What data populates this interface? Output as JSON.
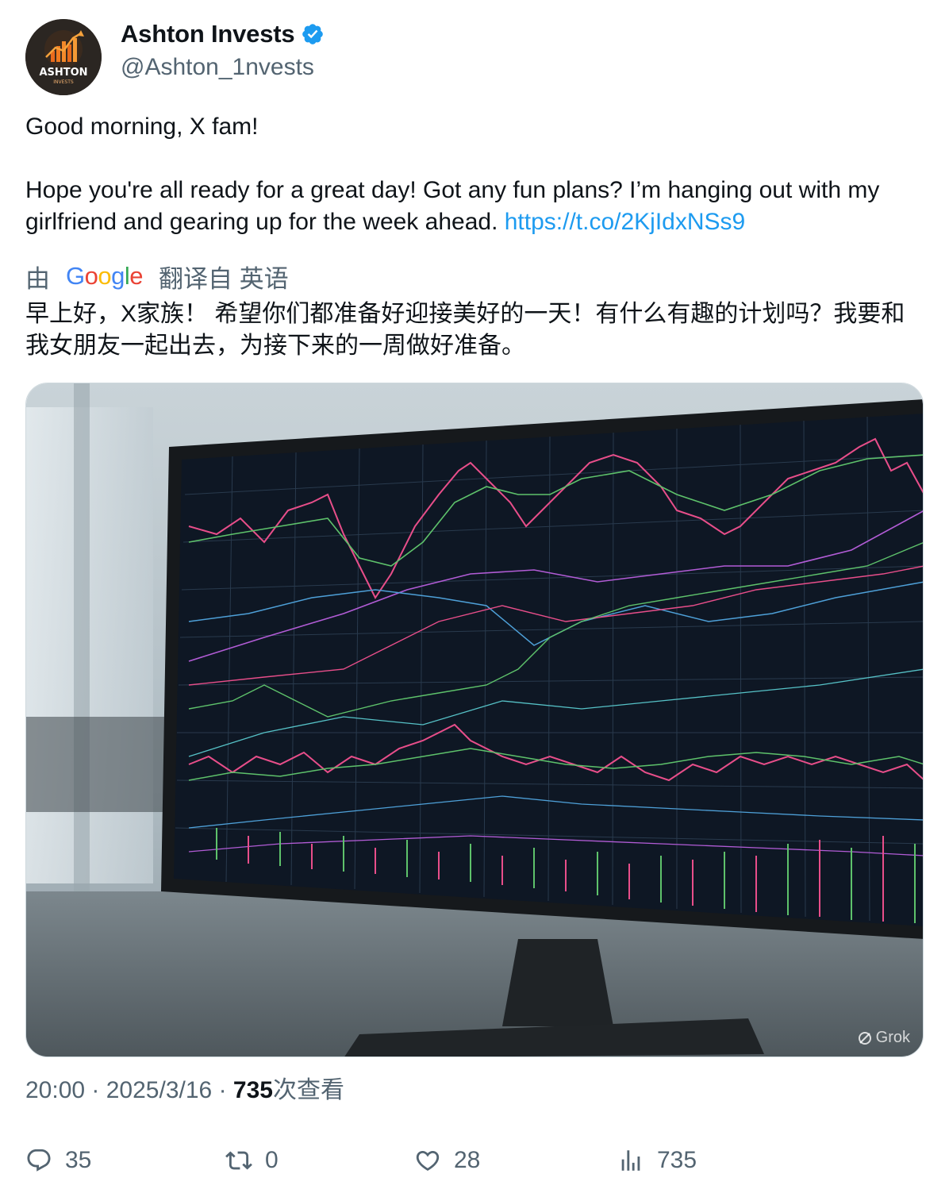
{
  "author": {
    "display_name": "Ashton Invests",
    "handle": "@Ashton_1nvests",
    "avatar_text": "ASHTON",
    "avatar_subtext": "INVESTS",
    "verified": true
  },
  "tweet": {
    "line1": "Good morning, X fam!",
    "line2": "Hope you're all ready for a great day! Got any fun plans? I’m hanging out with my girlfriend and gearing up for the week ahead. ",
    "link": "https://t.co/2KjIdxNSs9"
  },
  "translation": {
    "prefix": "由",
    "provider": "Google",
    "suffix": "翻译自 英语",
    "text": "早上好，X家族！ 希望你们都准备好迎接美好的一天！有什么有趣的计划吗？我要和我女朋友一起出去，为接下来的一周做好准备。"
  },
  "media": {
    "watermark": "Grok"
  },
  "meta": {
    "time": "20:00",
    "date": "2025/3/16",
    "views": "735",
    "views_label": "次查看"
  },
  "actions": {
    "replies": "35",
    "reposts": "0",
    "likes": "28",
    "views": "735"
  },
  "colors": {
    "link": "#1d9bf0",
    "muted": "#536471",
    "verified": "#1d9bf0"
  }
}
